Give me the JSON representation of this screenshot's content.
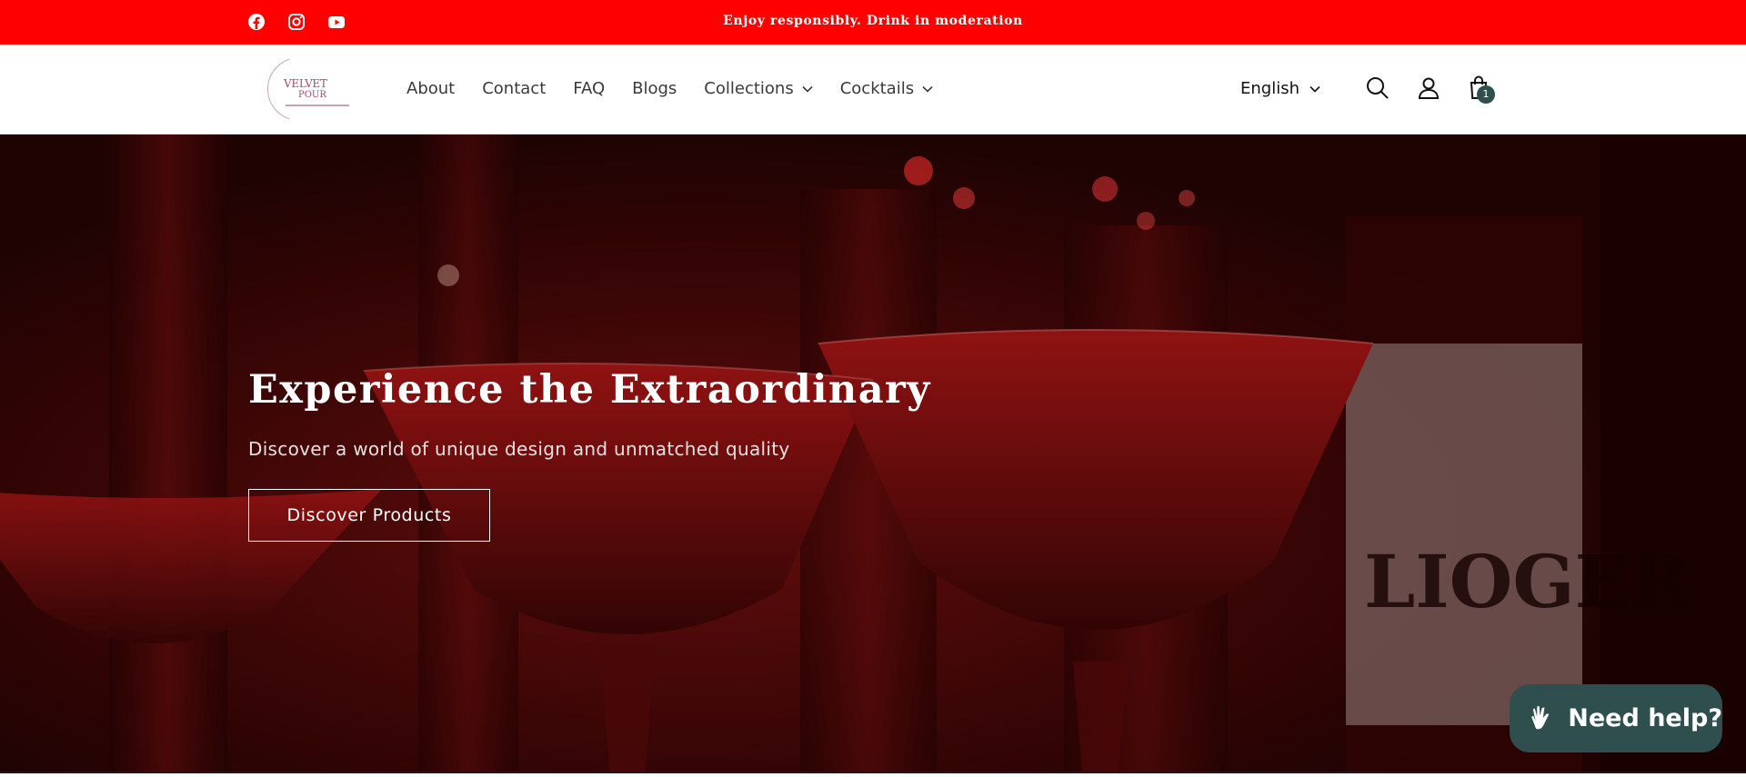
{
  "announcement": {
    "text": "Enjoy responsibly. Drink in moderation",
    "background": "#ff0000",
    "social_icons": [
      "facebook-icon",
      "instagram-icon",
      "youtube-icon"
    ]
  },
  "header": {
    "logo": {
      "line1": "VELVET",
      "line2": "POUR"
    },
    "nav": [
      {
        "label": "About",
        "has_dropdown": false
      },
      {
        "label": "Contact",
        "has_dropdown": false
      },
      {
        "label": "FAQ",
        "has_dropdown": false
      },
      {
        "label": "Blogs",
        "has_dropdown": false
      },
      {
        "label": "Collections",
        "has_dropdown": true
      },
      {
        "label": "Cocktails",
        "has_dropdown": true
      }
    ],
    "language": "English",
    "icons": [
      "search-icon",
      "account-icon",
      "cart-icon"
    ],
    "cart_count": "1"
  },
  "hero": {
    "title": "Experience the Extraordinary",
    "subtitle": "Discover a world of unique design and unmatched quality",
    "button_label": "Discover Products"
  },
  "help_widget": {
    "label": "Need help?",
    "background": "#2f4f4f"
  }
}
